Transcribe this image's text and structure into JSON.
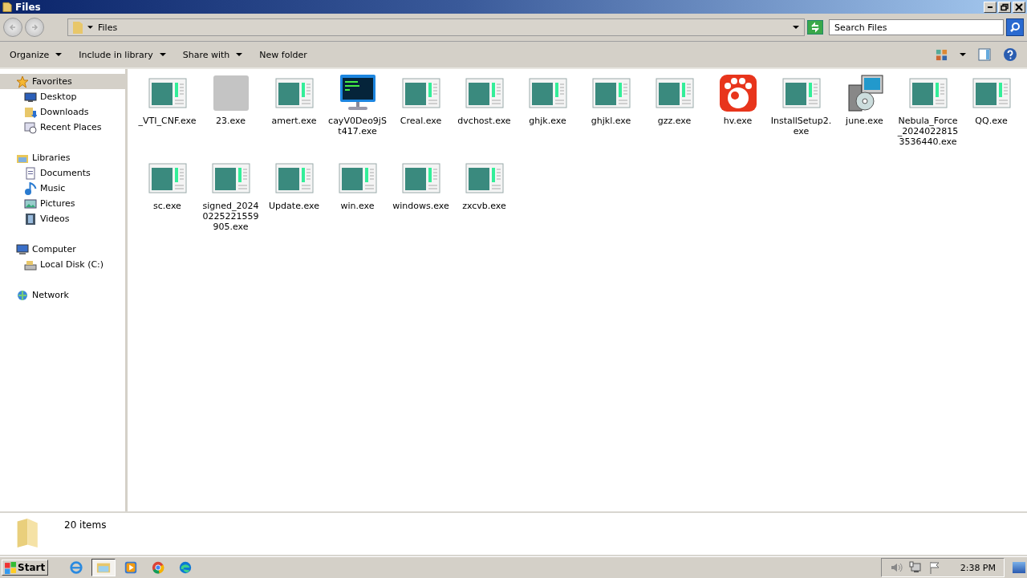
{
  "window": {
    "title": "Files"
  },
  "address": {
    "path": "Files"
  },
  "search": {
    "placeholder": "Search Files"
  },
  "toolbar": [
    {
      "label": "Organize",
      "dropdown": true
    },
    {
      "label": "Include in library",
      "dropdown": true
    },
    {
      "label": "Share with",
      "dropdown": true
    },
    {
      "label": "New folder",
      "dropdown": false
    }
  ],
  "nav": [
    {
      "label": "Favorites",
      "kind": "star",
      "selected": true,
      "children": [
        {
          "label": "Desktop",
          "kind": "desktop",
          "selected": false
        },
        {
          "label": "Downloads",
          "kind": "downloads",
          "selected": false
        },
        {
          "label": "Recent Places",
          "kind": "recent",
          "selected": false
        }
      ]
    },
    {
      "label": "Libraries",
      "kind": "libraries",
      "selected": false,
      "children": [
        {
          "label": "Documents",
          "kind": "documents",
          "selected": false
        },
        {
          "label": "Music",
          "kind": "music",
          "selected": false
        },
        {
          "label": "Pictures",
          "kind": "pictures",
          "selected": false
        },
        {
          "label": "Videos",
          "kind": "videos",
          "selected": false
        }
      ]
    },
    {
      "label": "Computer",
      "kind": "computer",
      "selected": false,
      "children": [
        {
          "label": "Local Disk (C:)",
          "kind": "disk",
          "selected": false
        }
      ]
    },
    {
      "label": "Network",
      "kind": "network",
      "selected": false
    }
  ],
  "files": [
    {
      "name": "_VTI_CNF.exe",
      "kind": "app"
    },
    {
      "name": "23.exe",
      "kind": "blurred"
    },
    {
      "name": "amert.exe",
      "kind": "app"
    },
    {
      "name": "cayV0Deo9jSt417.exe",
      "kind": "terminal"
    },
    {
      "name": "Creal.exe",
      "kind": "app"
    },
    {
      "name": "dvchost.exe",
      "kind": "app"
    },
    {
      "name": "ghjk.exe",
      "kind": "app"
    },
    {
      "name": "ghjkl.exe",
      "kind": "app"
    },
    {
      "name": "gzz.exe",
      "kind": "app"
    },
    {
      "name": "hv.exe",
      "kind": "red"
    },
    {
      "name": "InstallSetup2.exe",
      "kind": "app"
    },
    {
      "name": "june.exe",
      "kind": "installer"
    },
    {
      "name": "Nebula_Force_20240228153536440.exe",
      "kind": "app"
    },
    {
      "name": "QQ.exe",
      "kind": "app"
    },
    {
      "name": "sc.exe",
      "kind": "app"
    },
    {
      "name": "signed_20240225221559905.exe",
      "kind": "app"
    },
    {
      "name": "Update.exe",
      "kind": "app"
    },
    {
      "name": "win.exe",
      "kind": "app"
    },
    {
      "name": "windows.exe",
      "kind": "app"
    },
    {
      "name": "zxcvb.exe",
      "kind": "app"
    }
  ],
  "details": {
    "count": "20 items"
  },
  "taskbar": {
    "start": "Start",
    "apps": [
      {
        "kind": "ie",
        "selected": false
      },
      {
        "kind": "explorer",
        "selected": true
      },
      {
        "kind": "media",
        "selected": false
      },
      {
        "kind": "chrome",
        "selected": false
      },
      {
        "kind": "edge",
        "selected": false
      }
    ],
    "clock": "2:38 PM"
  }
}
